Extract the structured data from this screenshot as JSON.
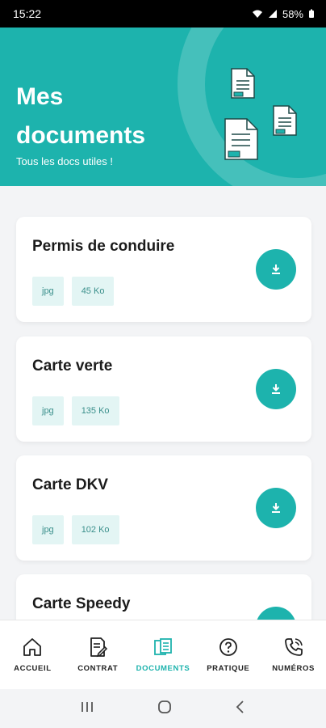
{
  "status_bar": {
    "time": "15:22",
    "battery": "58%"
  },
  "header": {
    "title_line1": "Mes",
    "title_line2": "documents",
    "subtitle": "Tous les docs utiles !",
    "accent_color": "#1db3ad"
  },
  "documents": [
    {
      "title": "Permis de conduire",
      "format": "jpg",
      "size": "45 Ko"
    },
    {
      "title": "Carte verte",
      "format": "jpg",
      "size": "135 Ko"
    },
    {
      "title": "Carte DKV",
      "format": "jpg",
      "size": "102 Ko"
    },
    {
      "title": "Carte Speedy"
    }
  ],
  "bottom_nav": [
    {
      "label": "ACCUEIL",
      "icon": "home-icon"
    },
    {
      "label": "CONTRAT",
      "icon": "contract-icon"
    },
    {
      "label": "DOCUMENTS",
      "icon": "documents-icon",
      "active": true
    },
    {
      "label": "PRATIQUE",
      "icon": "help-icon"
    },
    {
      "label": "NUMÉROS",
      "icon": "phone-icon"
    }
  ]
}
